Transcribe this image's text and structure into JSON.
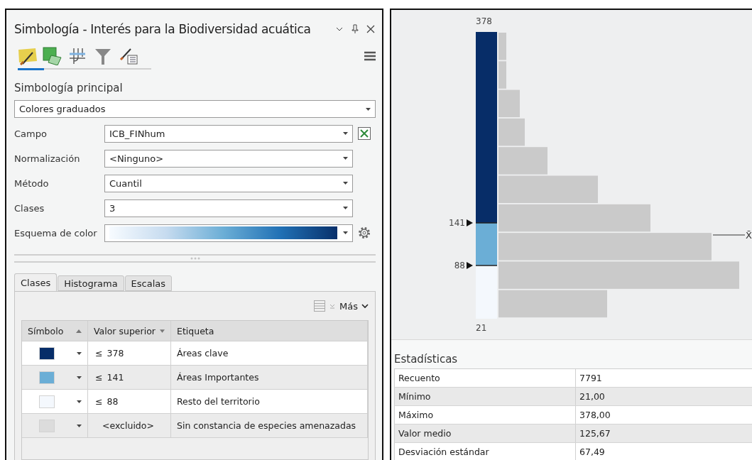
{
  "panel": {
    "title": "Simbología - Interés para la Biodiversidad acuática"
  },
  "toolbar_tabs": [
    {
      "kind": "primary",
      "selected": true
    },
    {
      "kind": "vary",
      "selected": false
    },
    {
      "kind": "labels",
      "selected": false
    },
    {
      "kind": "filter",
      "selected": false
    },
    {
      "kind": "display",
      "selected": false
    }
  ],
  "section_title": "Simbología principal",
  "renderer": {
    "value": "Colores graduados"
  },
  "fields": [
    {
      "kind": "expression",
      "label": "Campo",
      "value": "ICB_FINhum"
    },
    {
      "kind": "dropdown",
      "label": "Normalización",
      "value": "<Ninguno>"
    },
    {
      "kind": "dropdown",
      "label": "Método",
      "value": "Cuantil"
    },
    {
      "kind": "dropdown",
      "label": "Clases",
      "value": "3"
    },
    {
      "kind": "ramp",
      "label": "Esquema de color"
    }
  ],
  "tabs": [
    {
      "label": "Clases",
      "selected": true
    },
    {
      "label": "Histograma",
      "selected": false
    },
    {
      "label": "Escalas",
      "selected": false
    }
  ],
  "more_button": "Más",
  "classes_table": {
    "columns": [
      "Símbolo",
      "Valor superior",
      "Etiqueta"
    ],
    "rows": [
      {
        "color": "#072d68",
        "operator": "≤",
        "value": "378",
        "label": "Áreas clave"
      },
      {
        "color": "#6baed6",
        "operator": "≤",
        "value": "141",
        "label": "Áreas Importantes"
      },
      {
        "color": "#f4f8fd",
        "operator": "≤",
        "value": "88",
        "label": "Resto del territorio"
      },
      {
        "color": "#dcdcdc",
        "value": "<excluido>",
        "label": "Sin constancia de especies amenazadas"
      }
    ]
  },
  "histogram": {
    "max_label": "378",
    "min_label": "21",
    "breaks": [
      "141",
      "88"
    ],
    "mean_label": "X̄"
  },
  "statistics": {
    "title": "Estadísticas",
    "rows": [
      {
        "name": "Recuento",
        "value": "7791"
      },
      {
        "name": "Mínimo",
        "value": "21,00"
      },
      {
        "name": "Máximo",
        "value": "378,00"
      },
      {
        "name": "Valor medio",
        "value": "125,67"
      },
      {
        "name": "Desviación estándar",
        "value": "67,49"
      }
    ]
  }
}
